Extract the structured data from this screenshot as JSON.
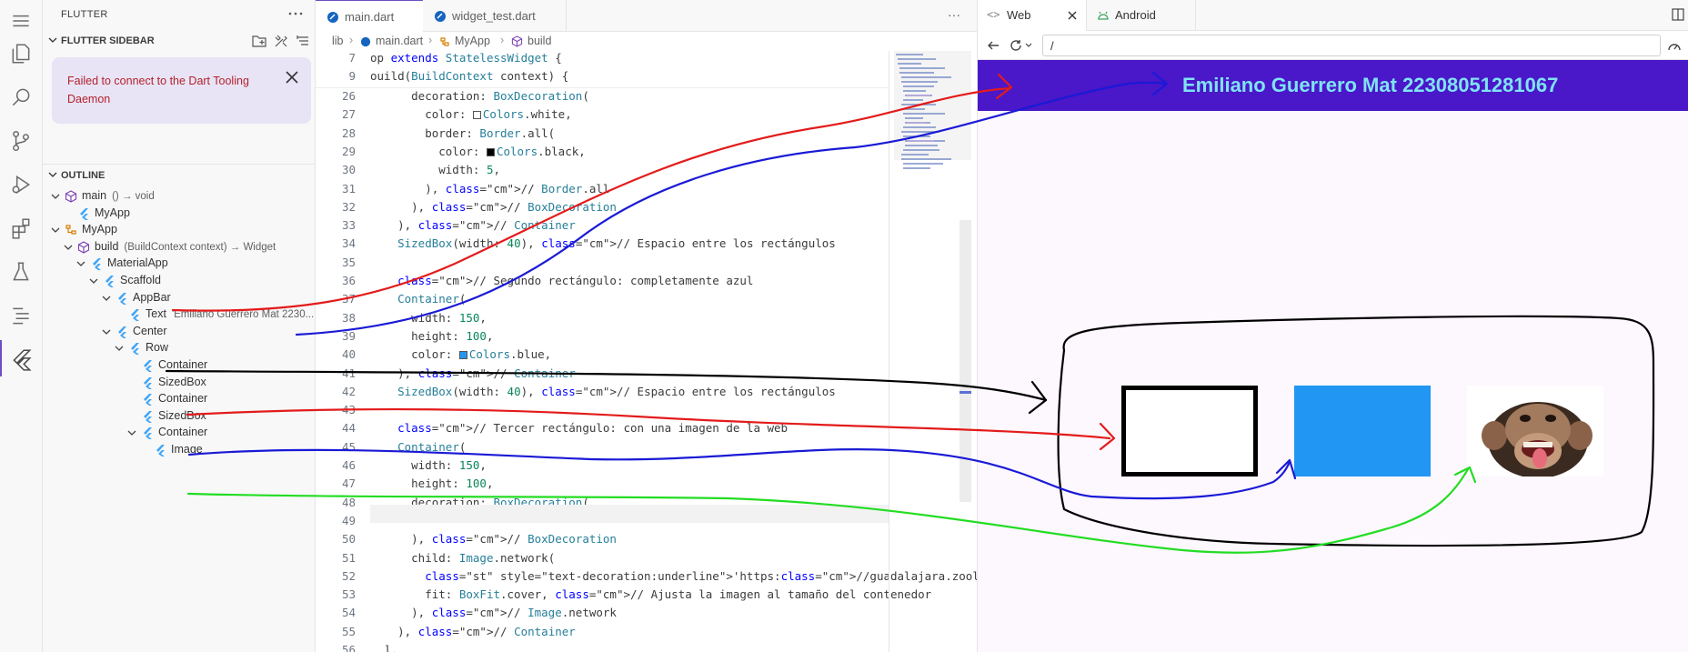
{
  "sidebar": {
    "header_title": "FLUTTER",
    "section_title": "FLUTTER SIDEBAR",
    "notice": "Failed to connect to the Dart Tooling Daemon",
    "outline_title": "OUTLINE",
    "tree": [
      {
        "label": "main",
        "desc": "() → void"
      },
      {
        "label": "MyApp",
        "desc": ""
      },
      {
        "label": "MyApp",
        "desc": ""
      },
      {
        "label": "build",
        "desc": "(BuildContext context) → Widget"
      },
      {
        "label": "MaterialApp",
        "desc": ""
      },
      {
        "label": "Scaffold",
        "desc": ""
      },
      {
        "label": "AppBar",
        "desc": ""
      },
      {
        "label": "Text",
        "desc": "'Emiliano Guerrero Mat 2230..."
      },
      {
        "label": "Center",
        "desc": ""
      },
      {
        "label": "Row",
        "desc": ""
      },
      {
        "label": "Container",
        "desc": ""
      },
      {
        "label": "SizedBox",
        "desc": ""
      },
      {
        "label": "Container",
        "desc": ""
      },
      {
        "label": "SizedBox",
        "desc": ""
      },
      {
        "label": "Container",
        "desc": ""
      },
      {
        "label": "Image",
        "desc": ""
      }
    ]
  },
  "editor": {
    "tabs": [
      {
        "label": "main.dart"
      },
      {
        "label": "widget_test.dart"
      }
    ],
    "breadcrumb": [
      "lib",
      "main.dart",
      "MyApp",
      "build"
    ],
    "more": "···",
    "sticky": [
      {
        "ln": "7",
        "code": "op extends StatelessWidget {"
      },
      {
        "ln": "9",
        "code": "ouild(BuildContext context) {"
      }
    ],
    "lines": [
      {
        "ln": "26",
        "code": "      decoration: BoxDecoration("
      },
      {
        "ln": "27",
        "code": "        color: ☐Colors.white,"
      },
      {
        "ln": "28",
        "code": "        border: Border.all("
      },
      {
        "ln": "29",
        "code": "          color: ■Colors.black,"
      },
      {
        "ln": "30",
        "code": "          width: 5,"
      },
      {
        "ln": "31",
        "code": "        ), // Border.all"
      },
      {
        "ln": "32",
        "code": "      ), // BoxDecoration"
      },
      {
        "ln": "33",
        "code": "    ), // Container"
      },
      {
        "ln": "34",
        "code": "    SizedBox(width: 40), // Espacio entre los rectángulos"
      },
      {
        "ln": "35",
        "code": ""
      },
      {
        "ln": "36",
        "code": "    // Segundo rectángulo: completamente azul"
      },
      {
        "ln": "37",
        "code": "    Container("
      },
      {
        "ln": "38",
        "code": "      width: 150,"
      },
      {
        "ln": "39",
        "code": "      height: 100,"
      },
      {
        "ln": "40",
        "code": "      color: ■Colors.blue,"
      },
      {
        "ln": "41",
        "code": "    ), // Container"
      },
      {
        "ln": "42",
        "code": "    SizedBox(width: 40), // Espacio entre los rectángulos"
      },
      {
        "ln": "43",
        "code": ""
      },
      {
        "ln": "44",
        "code": "    // Tercer rectángulo: con una imagen de la web"
      },
      {
        "ln": "45",
        "code": "    Container("
      },
      {
        "ln": "46",
        "code": "      width: 150,"
      },
      {
        "ln": "47",
        "code": "      height: 100,"
      },
      {
        "ln": "48",
        "code": "      decoration: BoxDecoration("
      },
      {
        "ln": "49",
        "code": ""
      },
      {
        "ln": "50",
        "code": "      ), // BoxDecoration"
      },
      {
        "ln": "51",
        "code": "      child: Image.network("
      },
      {
        "ln": "52",
        "code": "        'https://guadalajara.zoologico.tour.gdltours.com/blog/wp-content"
      },
      {
        "ln": "53",
        "code": "        fit: BoxFit.cover, // Ajusta la imagen al tamaño del contenedor"
      },
      {
        "ln": "54",
        "code": "      ), // Image.network"
      },
      {
        "ln": "55",
        "code": "    ), // Container"
      },
      {
        "ln": "56",
        "code": "  ],"
      }
    ]
  },
  "preview": {
    "tabs": [
      {
        "label": "Web"
      },
      {
        "label": "Android"
      }
    ],
    "url": "/",
    "appbar_title": "Emiliano Guerrero Mat 22308051281067"
  },
  "colors": {
    "accent": "#6c4fc4",
    "appbar": "#4a17c9",
    "appbar_text": "#7fe3f3",
    "blue_rect": "#2196f3",
    "annot_red": "#e31b1b",
    "annot_blue": "#1a1ad6",
    "annot_black": "#000000",
    "annot_green": "#22dd22"
  }
}
